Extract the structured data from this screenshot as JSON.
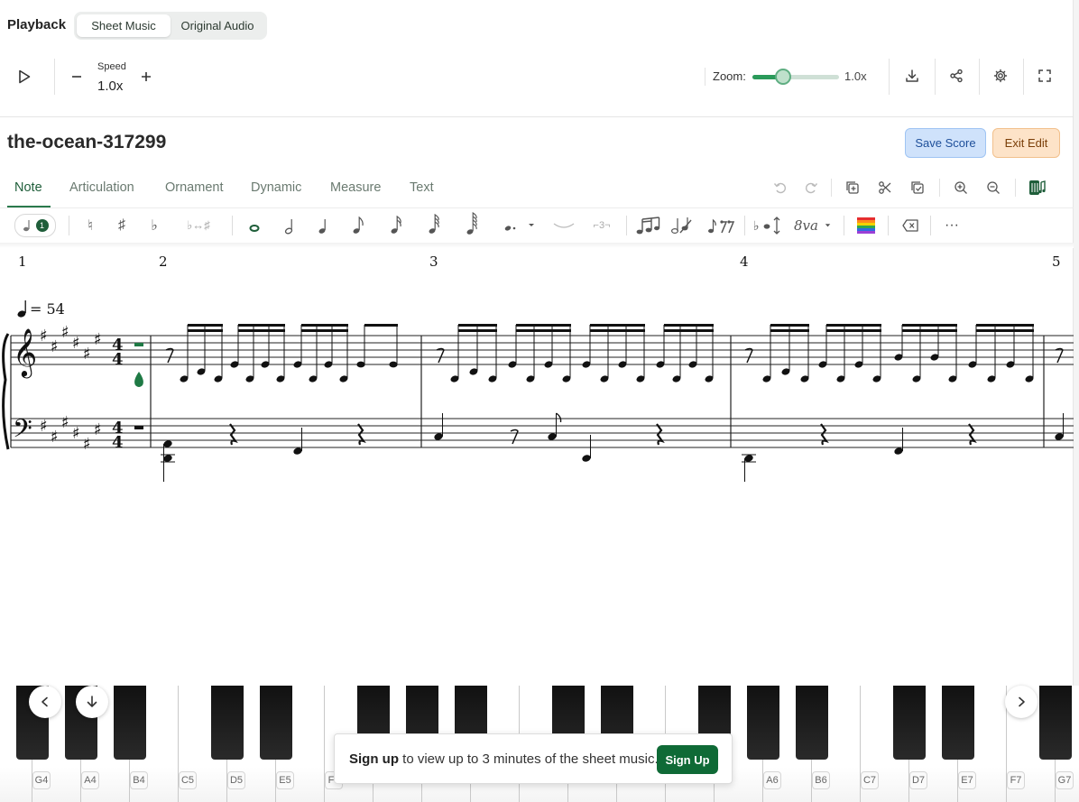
{
  "header": {
    "title": "Playback",
    "modes": [
      {
        "label": "Sheet Music",
        "active": true
      },
      {
        "label": "Original Audio",
        "active": false
      }
    ]
  },
  "controls": {
    "speed_label": "Speed",
    "speed_value": "1.0x",
    "zoom_label": "Zoom:",
    "zoom_value": "1.0x",
    "zoom_level": 0.35,
    "accent_color": "#2a9a5a"
  },
  "score": {
    "title": "the-ocean-317299",
    "save_label": "Save Score",
    "exit_label": "Exit Edit",
    "tempo_text": "= 54",
    "measure_numbers": [
      "1",
      "2",
      "3",
      "4",
      "5"
    ]
  },
  "tabs": [
    {
      "label": "Note",
      "active": true
    },
    {
      "label": "Articulation",
      "active": false
    },
    {
      "label": "Ornament",
      "active": false
    },
    {
      "label": "Dynamic",
      "active": false
    },
    {
      "label": "Measure",
      "active": false
    },
    {
      "label": "Text",
      "active": false
    }
  ],
  "toolbar": {
    "voice_number": "1",
    "octave_text": "8va"
  },
  "piano": {
    "labels": [
      "G4",
      "A4",
      "B4",
      "C5",
      "D5",
      "E5",
      "F5",
      "A6",
      "B6",
      "C7",
      "D7",
      "E7",
      "F7",
      "G7"
    ]
  },
  "signup": {
    "bold_text": "Sign up",
    "rest_text": " to view up to 3 minutes of the sheet music.",
    "button_label": "Sign Up"
  }
}
